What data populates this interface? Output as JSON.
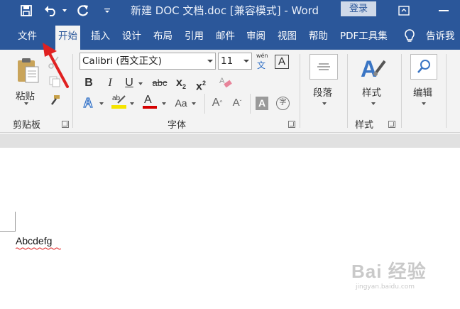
{
  "title_bar": {
    "doc_title": "新建 DOC 文档.doc [兼容模式] - Word",
    "login_label": "登录"
  },
  "tabs": [
    "文件",
    "开始",
    "插入",
    "设计",
    "布局",
    "引用",
    "邮件",
    "审阅",
    "视图",
    "帮助",
    "PDF工具集",
    "告诉我"
  ],
  "active_tab": "开始",
  "clipboard": {
    "paste_label": "粘贴",
    "group_label": "剪贴板"
  },
  "font": {
    "font_name": "Calibri (西文正文)",
    "font_size": "11",
    "phonetic_top": "wén",
    "phonetic_bottom": "文",
    "clear_box": "A",
    "bold": "B",
    "italic": "I",
    "underline": "U",
    "strike": "abc",
    "sub": "x",
    "sub_small": "2",
    "sup": "x",
    "sup_small": "2",
    "text_effect": "A",
    "highlight_text": "ab",
    "font_color": "A",
    "change_case": "Aa",
    "grow": "A",
    "shrink": "A",
    "char_shading": "A",
    "enclose": "字",
    "group_label": "字体",
    "highlight_color": "#f5e400",
    "font_color_bar": "#d50000"
  },
  "paragraph": {
    "label": "段落"
  },
  "styles": {
    "label": "样式",
    "group_label": "样式"
  },
  "editing": {
    "label": "编辑"
  },
  "document": {
    "text": "Abcdefg"
  },
  "watermark": {
    "main": "Bai 经验",
    "sub": "jingyan.baidu.com"
  },
  "colors": {
    "title_bar": "#2b579a",
    "ribbon": "#f3f3f3",
    "arrow": "#e02020"
  }
}
